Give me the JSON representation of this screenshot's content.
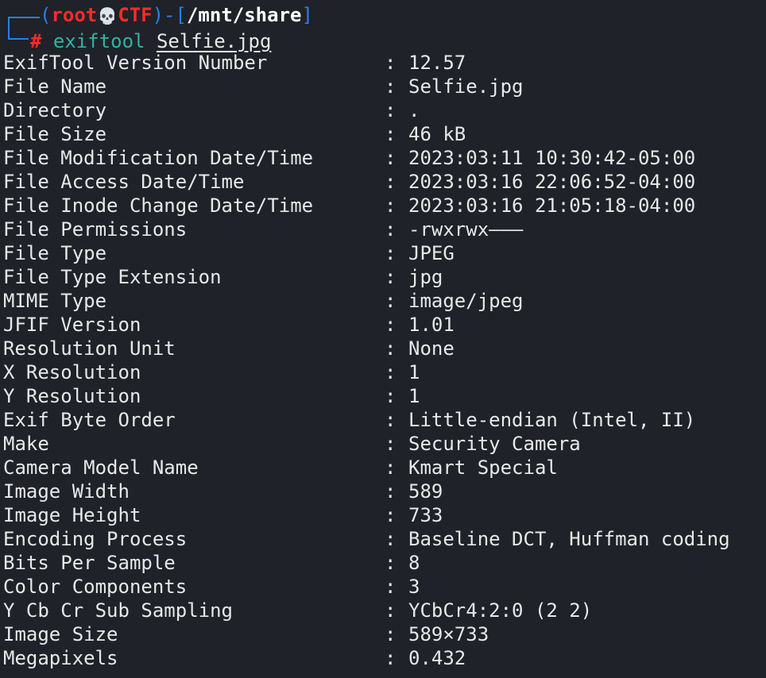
{
  "prompt": {
    "open_paren": "(",
    "user": "root",
    "skull": "💀",
    "host": "CTF",
    "close_paren_dash": ")-[",
    "cwd": "/mnt/share",
    "close_bracket": "]",
    "hash": "#",
    "command": "exiftool",
    "argument": "Selfie.jpg"
  },
  "separator": ":",
  "rows": [
    {
      "key": "ExifTool Version Number",
      "value": "12.57"
    },
    {
      "key": "File Name",
      "value": "Selfie.jpg"
    },
    {
      "key": "Directory",
      "value": "."
    },
    {
      "key": "File Size",
      "value": "46 kB"
    },
    {
      "key": "File Modification Date/Time",
      "value": "2023:03:11 10:30:42-05:00"
    },
    {
      "key": "File Access Date/Time",
      "value": "2023:03:16 22:06:52-04:00"
    },
    {
      "key": "File Inode Change Date/Time",
      "value": "2023:03:16 21:05:18-04:00"
    },
    {
      "key": "File Permissions",
      "value": "-rwxrwx———"
    },
    {
      "key": "File Type",
      "value": "JPEG"
    },
    {
      "key": "File Type Extension",
      "value": "jpg"
    },
    {
      "key": "MIME Type",
      "value": "image/jpeg"
    },
    {
      "key": "JFIF Version",
      "value": "1.01"
    },
    {
      "key": "Resolution Unit",
      "value": "None"
    },
    {
      "key": "X Resolution",
      "value": "1"
    },
    {
      "key": "Y Resolution",
      "value": "1"
    },
    {
      "key": "Exif Byte Order",
      "value": "Little-endian (Intel, II)"
    },
    {
      "key": "Make",
      "value": "Security Camera"
    },
    {
      "key": "Camera Model Name",
      "value": "Kmart Special"
    },
    {
      "key": "Image Width",
      "value": "589"
    },
    {
      "key": "Image Height",
      "value": "733"
    },
    {
      "key": "Encoding Process",
      "value": "Baseline DCT, Huffman coding"
    },
    {
      "key": "Bits Per Sample",
      "value": "8"
    },
    {
      "key": "Color Components",
      "value": "3"
    },
    {
      "key": "Y Cb Cr Sub Sampling",
      "value": "YCbCr4:2:0 (2 2)"
    },
    {
      "key": "Image Size",
      "value": "589×733"
    },
    {
      "key": "Megapixels",
      "value": "0.432"
    }
  ],
  "colors": {
    "background": "#1f2229",
    "foreground": "#e8e8e8",
    "prompt_bracket": "#2e7de9",
    "prompt_user_host": "#ff2b2b",
    "command": "#30b3a3"
  }
}
